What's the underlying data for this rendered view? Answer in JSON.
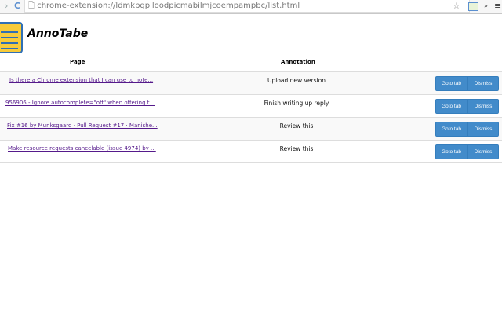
{
  "browser": {
    "url": "chrome-extension://ldmkbgpiloodpicmabilmjcoempampbc/list.html"
  },
  "app": {
    "title": "AnnoTabe"
  },
  "table": {
    "headers": [
      "Page",
      "Annotation"
    ],
    "rows": [
      {
        "page": "Is there a Chrome extension that I can use to note...",
        "annotation": "Upload new version"
      },
      {
        "page": "956906 - Ignore autocomplete=\"off\" when offering t...",
        "annotation": "Finish writing up reply"
      },
      {
        "page": "Fix #16 by Munksgaard · Pull Request #17 · Manishe...",
        "annotation": "Review this"
      },
      {
        "page": "Make resource requests cancelable (issue 4974) by ...",
        "annotation": "Review this"
      }
    ],
    "goto_label": "Goto tab",
    "dismiss_label": "Dismiss"
  },
  "colors": {
    "button": "#428bca",
    "link": "#551a8b",
    "logo": "#f7cb3a"
  }
}
